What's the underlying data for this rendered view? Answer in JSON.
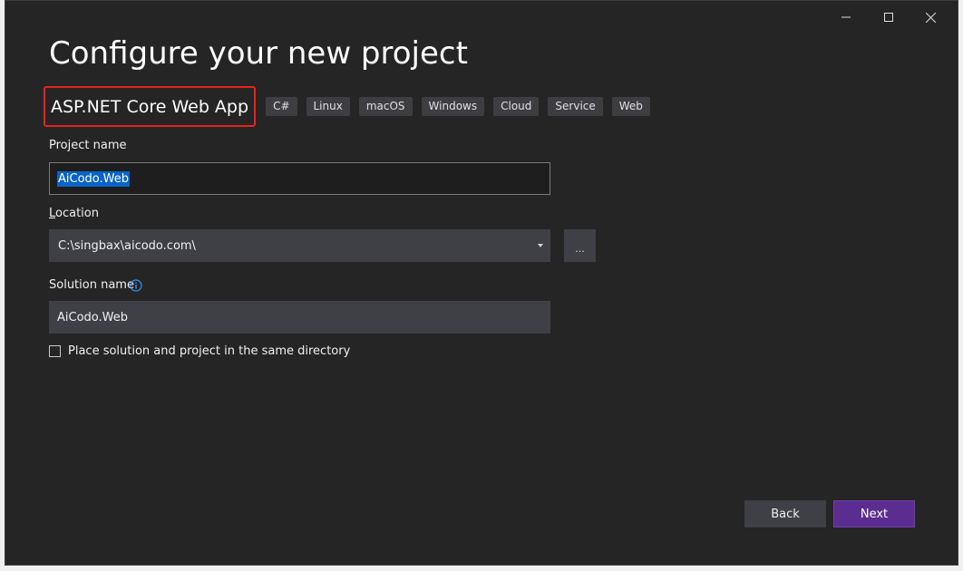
{
  "window": {
    "controls": {
      "minimize": "minimize",
      "maximize": "maximize",
      "close": "close"
    }
  },
  "header": {
    "title": "Configure your new project"
  },
  "template": {
    "name": "ASP.NET Core Web App",
    "tags": [
      "C#",
      "Linux",
      "macOS",
      "Windows",
      "Cloud",
      "Service",
      "Web"
    ]
  },
  "form": {
    "project_name": {
      "label": "Project name",
      "value": "AiCodo.Web"
    },
    "location": {
      "label": "Location",
      "value": "C:\\singbax\\aicodo.com\\",
      "browse_label": "..."
    },
    "solution_name": {
      "label": "Solution name",
      "value": "AiCodo.Web"
    },
    "same_directory": {
      "label": "Place solution and project in the same directory",
      "checked": false
    }
  },
  "footer": {
    "back_label": "Back",
    "next_label": "Next"
  },
  "colors": {
    "background": "#252526",
    "input_bg": "#3f3f46",
    "accent": "#5c2d91",
    "highlight_border": "#e8221e",
    "selection": "#0a64c8"
  }
}
